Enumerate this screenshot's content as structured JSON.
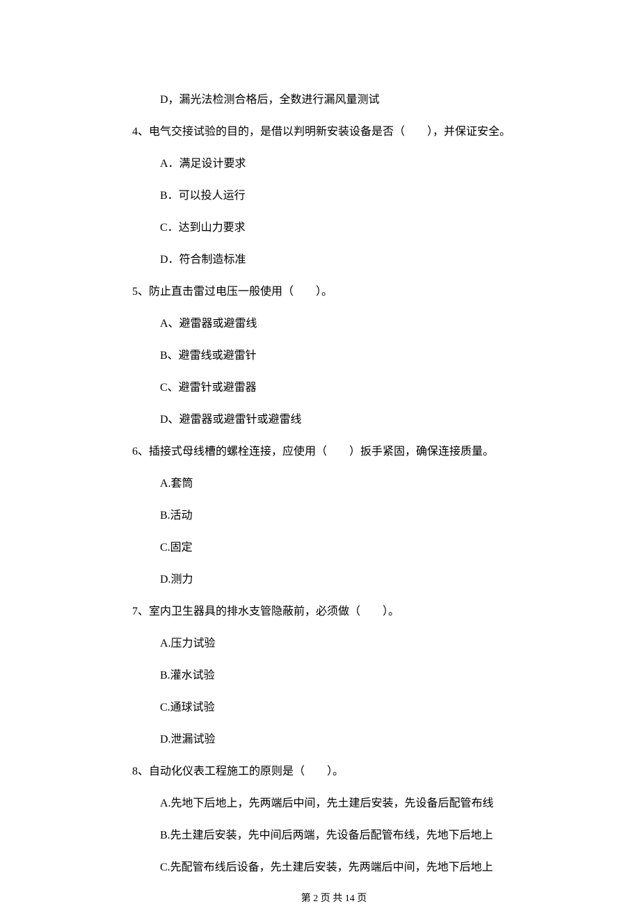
{
  "q3": {
    "options": {
      "d": "D，漏光法检测合格后，全数进行漏风量测试"
    }
  },
  "q4": {
    "text": "4、电气交接试验的目的，是借以判明新安装设备是否（　　），并保证安全。",
    "options": {
      "a": "A．满足设计要求",
      "b": "B．可以投人运行",
      "c": "C．达到山力要求",
      "d": "D．符合制造标准"
    }
  },
  "q5": {
    "text": "5、防止直击雷过电压一般使用（　　）。",
    "options": {
      "a": "A、避雷器或避雷线",
      "b": "B、避雷线或避雷针",
      "c": "C、避雷针或避雷器",
      "d": "D、避雷器或避雷针或避雷线"
    }
  },
  "q6": {
    "text": "6、插接式母线槽的螺栓连接，应使用（　　）扳手紧固，确保连接质量。",
    "options": {
      "a": "A.套筒",
      "b": "B.活动",
      "c": "C.固定",
      "d": "D.测力"
    }
  },
  "q7": {
    "text": "7、室内卫生器具的排水支管隐蔽前，必须做（　　）。",
    "options": {
      "a": "A.压力试验",
      "b": "B.灌水试验",
      "c": "C.通球试验",
      "d": "D.泄漏试验"
    }
  },
  "q8": {
    "text": "8、自动化仪表工程施工的原则是（　　）。",
    "options": {
      "a": "A.先地下后地上，先两端后中间，先土建后安装，先设备后配管布线",
      "b": "B.先土建后安装，先中间后两端，先设备后配管布线，先地下后地上",
      "c": "C.先配管布线后设备，先土建后安装，先两端后中间，先地下后地上"
    }
  },
  "footer": "第 2 页 共 14 页"
}
